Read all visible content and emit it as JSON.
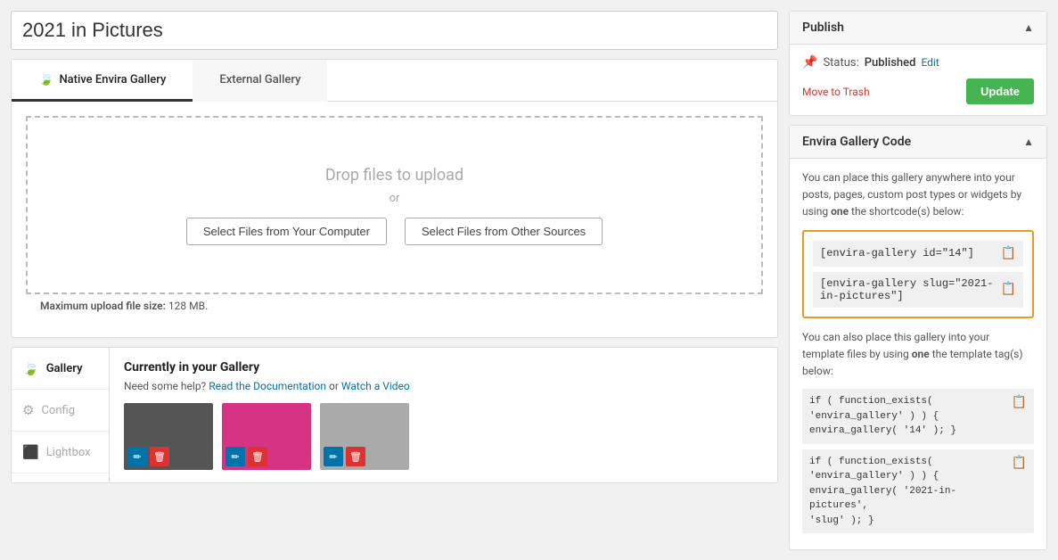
{
  "page": {
    "title": "2021 in Pictures"
  },
  "tabs": [
    {
      "id": "native",
      "label": "Native Envira Gallery",
      "active": true,
      "icon": "🍃"
    },
    {
      "id": "external",
      "label": "External Gallery",
      "active": false,
      "icon": ""
    }
  ],
  "upload": {
    "drop_text": "Drop files to upload",
    "or_text": "or",
    "btn_computer": "Select Files from Your Computer",
    "btn_other": "Select Files from Other Sources",
    "max_size_label": "Maximum upload file size:",
    "max_size_value": "128 MB."
  },
  "sidebar_nav": [
    {
      "id": "gallery",
      "label": "Gallery",
      "icon": "🍃",
      "active": true
    },
    {
      "id": "config",
      "label": "Config",
      "icon": "⚙",
      "active": false
    },
    {
      "id": "lightbox",
      "label": "Lightbox",
      "icon": "⬛",
      "active": false
    }
  ],
  "gallery_section": {
    "title": "Currently in your Gallery",
    "help_prefix": "Need some help?",
    "help_doc": "Read the Documentation",
    "help_or": "or",
    "help_video": "Watch a Video",
    "thumbs": [
      {
        "id": "thumb1",
        "color": "#555"
      },
      {
        "id": "thumb2",
        "color": "#d63384"
      },
      {
        "id": "thumb3",
        "color": "#aaa"
      }
    ]
  },
  "publish_panel": {
    "title": "Publish",
    "status_label": "Status:",
    "status_value": "Published",
    "edit_link": "Edit",
    "trash_link": "Move to Trash",
    "update_btn": "Update"
  },
  "code_panel": {
    "title": "Envira Gallery Code",
    "info_text": "You can place this gallery anywhere into your posts, pages, custom post types or widgets by using",
    "info_bold": "one",
    "info_text2": "the shortcode(s) below:",
    "shortcodes": [
      "[envira-gallery id=\"14\"]",
      "[envira-gallery slug=\"2021-in-pictures\"]"
    ],
    "template_info_text": "You can also place this gallery into your template files by using",
    "template_info_bold": "one",
    "template_info_text2": "the template tag(s) below:",
    "template_codes": [
      "if ( function_exists(\n'envira_gallery' ) ) {\nenvira_gallery( '14' ); }",
      "if ( function_exists(\n'envira_gallery' ) ) {\nenvira_gallery( '2021-in-pictures',\n'slug' ); }"
    ]
  }
}
